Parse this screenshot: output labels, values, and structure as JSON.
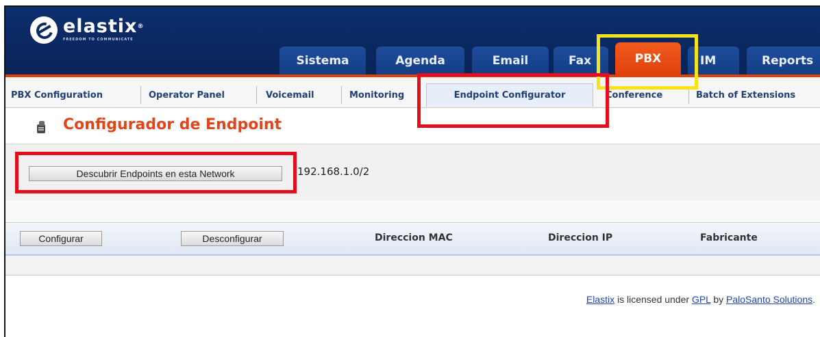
{
  "header": {
    "logo_text": "elastix",
    "logo_reg": "®",
    "logo_tagline": "FREEDOM TO COMMUNICATE",
    "tabs": [
      {
        "label": "Sistema"
      },
      {
        "label": "Agenda"
      },
      {
        "label": "Email"
      },
      {
        "label": "Fax"
      },
      {
        "label": "PBX",
        "active": true
      },
      {
        "label": "IM"
      },
      {
        "label": "Reports"
      }
    ],
    "accent_color": "#e0400b",
    "bar_color": "#0b2a63"
  },
  "submenu": {
    "items": [
      {
        "label": "PBX Configuration"
      },
      {
        "label": "Operator Panel"
      },
      {
        "label": "Voicemail"
      },
      {
        "label": "Monitoring"
      },
      {
        "label": "Endpoint Configurator",
        "active": true
      },
      {
        "label": "Conference"
      },
      {
        "label": "Batch of Extensions"
      }
    ]
  },
  "page": {
    "icon": "phone-icon",
    "title": "Configurador de Endpoint",
    "discover_button": "Descubrir Endpoints en esta Network",
    "network_value": "192.168.1.0/2"
  },
  "table": {
    "configure_button": "Configurar",
    "unconfigure_button": "Desconfigurar",
    "columns": [
      "Direccion MAC",
      "Direccion IP",
      "Fabricante"
    ]
  },
  "footer": {
    "link1": "Elastix",
    "text1": " is licensed under ",
    "link2": "GPL",
    "text2": " by ",
    "link3": "PaloSanto Solutions",
    "text3": "."
  },
  "annotations": {
    "highlight_red": "#e30e1d",
    "highlight_yellow": "#f6e41a"
  }
}
